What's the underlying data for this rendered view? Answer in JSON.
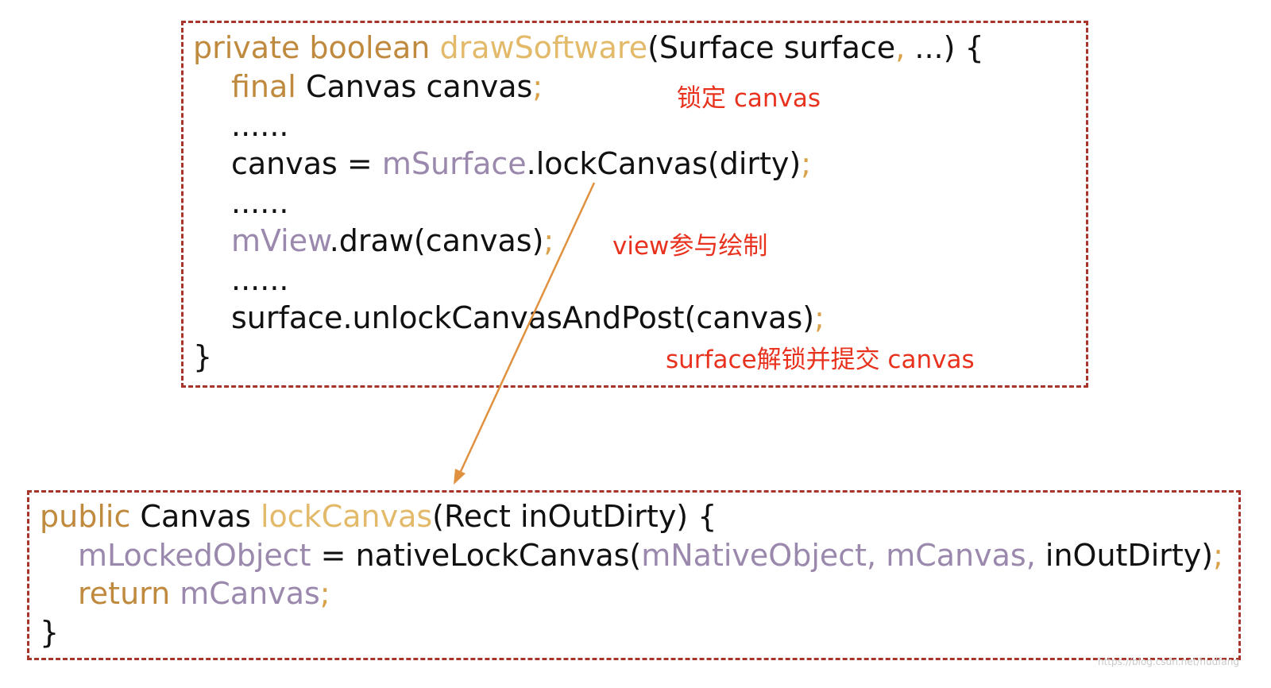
{
  "top_block": {
    "line1": {
      "kw1": "private boolean ",
      "method": "drawSoftware",
      "args": "(Surface surface",
      "comma": ",",
      "rest": " ...) {"
    },
    "line2": {
      "kw": "final",
      "text": " Canvas canvas",
      "semi": ";"
    },
    "line3": {
      "text": "......"
    },
    "line4": {
      "pre": "canvas = ",
      "field": "mSurface",
      "call": ".lockCanvas(dirty)",
      "semi": ";"
    },
    "line5": {
      "text": "......"
    },
    "line6": {
      "field": "mView",
      "call": ".draw(canvas)",
      "semi": ";"
    },
    "line7": {
      "text": "......"
    },
    "line8": {
      "call": "surface.unlockCanvasAndPost(canvas)",
      "semi": ";"
    },
    "line9": {
      "text": "}"
    }
  },
  "bottom_block": {
    "line1": {
      "kw": "public",
      "type": " Canvas ",
      "method": "lockCanvas",
      "args": "(Rect inOutDirty) {"
    },
    "line2": {
      "field1": "mLockedObject",
      "eq": " = nativeLockCanvas(",
      "field2": "mNativeObject",
      "c1": ",",
      "field3": " mCanvas",
      "c2": ",",
      "arg": " inOutDirty)",
      "semi": ";"
    },
    "line3": {
      "kw": "return",
      "field": " mCanvas",
      "semi": ";"
    },
    "line4": {
      "text": "}"
    }
  },
  "annotations": {
    "lock": "锁定 canvas",
    "draw": "view参与绘制",
    "unlock": "surface解锁并提交 canvas"
  },
  "watermark": "https://blog.csdn.net/hudfang",
  "colors": {
    "border": "#a8352b",
    "keyword": "#c08a3e",
    "method": "#e3b96a",
    "field": "#9a88ad",
    "annotation": "#e8321e",
    "arrow": "#e0913f"
  }
}
